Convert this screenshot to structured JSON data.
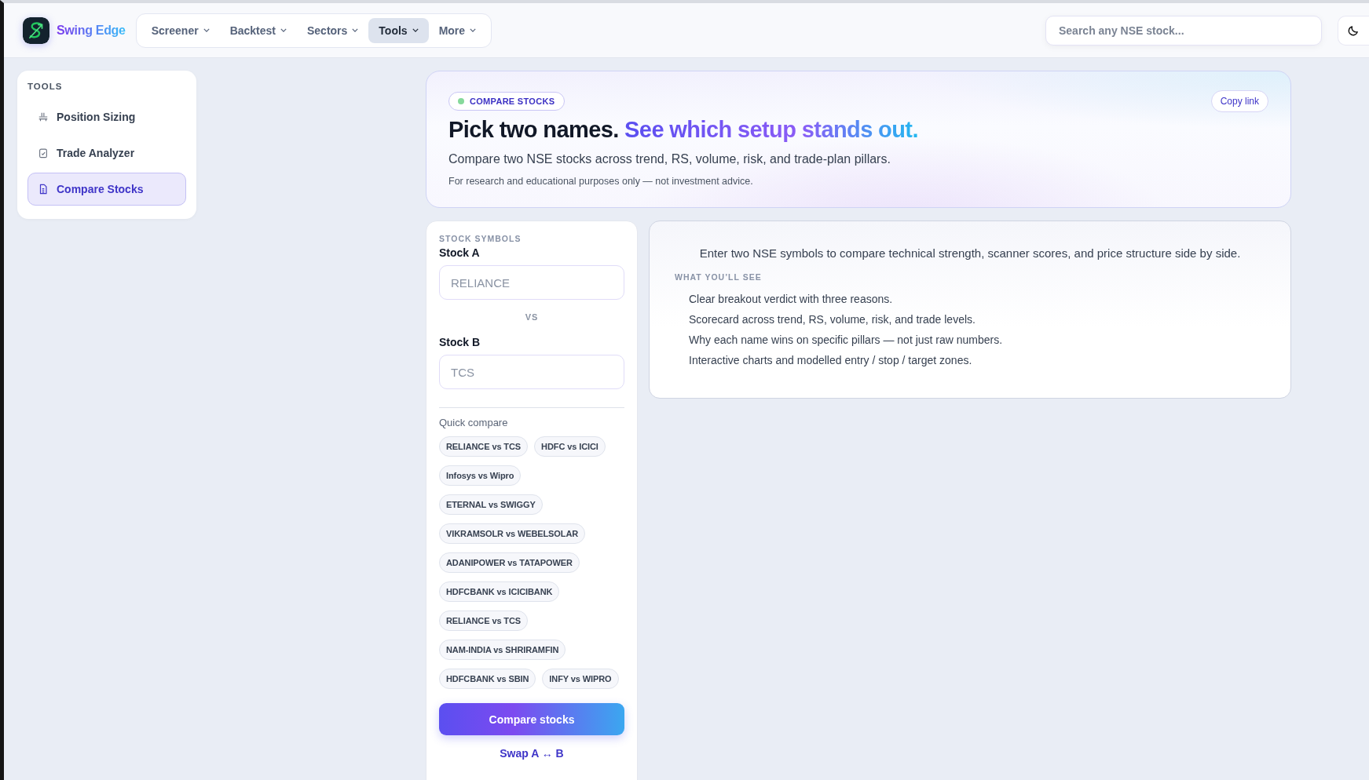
{
  "brand": {
    "name": "Swing Edge"
  },
  "nav": [
    {
      "label": "Screener",
      "selected": false
    },
    {
      "label": "Backtest",
      "selected": false
    },
    {
      "label": "Sectors",
      "selected": false
    },
    {
      "label": "Tools",
      "selected": true
    },
    {
      "label": "More",
      "selected": false
    }
  ],
  "search": {
    "placeholder": "Search any NSE stock..."
  },
  "sidebar": {
    "heading": "TOOLS",
    "items": [
      {
        "label": "Position Sizing",
        "kind": "scale",
        "selected": false
      },
      {
        "label": "Trade Analyzer",
        "kind": "clipboard",
        "selected": false
      },
      {
        "label": "Compare Stocks",
        "kind": "document",
        "selected": true
      }
    ]
  },
  "hero": {
    "badge": "COMPARE STOCKS",
    "copy_link": "Copy link",
    "title_lead": "Pick two names.",
    "title_accent": "See which setup stands out.",
    "subtitle": "Compare two NSE stocks across trend, RS, volume, risk, and trade-plan pillars.",
    "disclaimer": "For research and educational purposes only — not investment advice."
  },
  "form": {
    "heading": "STOCK SYMBOLS",
    "stock_a": {
      "label": "Stock A",
      "placeholder": "RELIANCE"
    },
    "vs": "VS",
    "stock_b": {
      "label": "Stock B",
      "placeholder": "TCS"
    },
    "quick_compare_label": "Quick compare",
    "quick_compare": [
      "RELIANCE vs TCS",
      "HDFC vs ICICI",
      "Infosys vs Wipro",
      "ETERNAL vs SWIGGY",
      "VIKRAMSOLR vs WEBELSOLAR",
      "ADANIPOWER vs TATAPOWER",
      "HDFCBANK vs ICICIBANK",
      "RELIANCE vs TCS",
      "NAM-INDIA vs SHRIRAMFIN",
      "HDFCBANK vs SBIN",
      "INFY vs WIPRO"
    ],
    "submit": "Compare stocks",
    "swap": "Swap A ↔ B"
  },
  "info": {
    "intro": "Enter two NSE symbols to compare technical strength, scanner scores, and price structure side by side.",
    "heading": "WHAT YOU’LL SEE",
    "items": [
      "Clear breakout verdict with three reasons.",
      "Scorecard across trend, RS, volume, risk, and trade levels.",
      "Why each name wins on specific pillars — not just raw numbers.",
      "Interactive charts and modelled entry / stop / target zones."
    ]
  }
}
